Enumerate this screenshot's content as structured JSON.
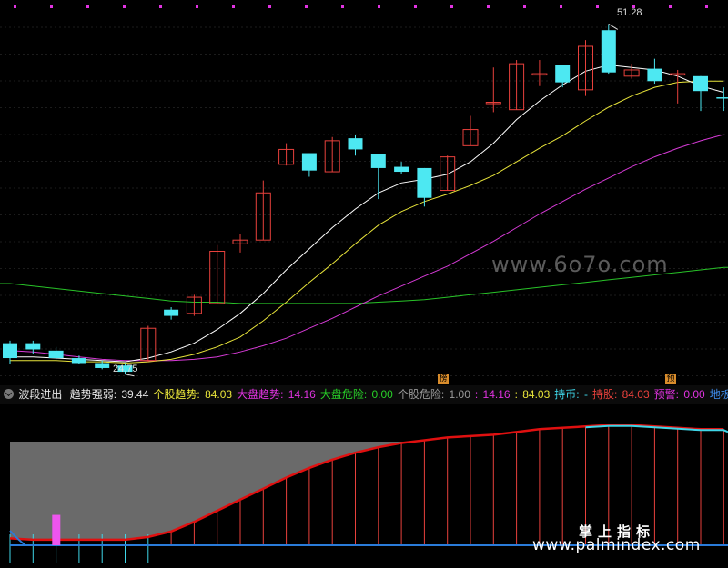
{
  "colors": {
    "up": "#e8413c",
    "down": "#4de8f2",
    "ma_white": "#ffffff",
    "ma_yellow": "#e8e43a",
    "ma_magenta": "#d63ad6",
    "ma_green": "#28c228",
    "dots": "#e233e2",
    "trend_red": "#e01010",
    "fill_gray": "#6a6a6a",
    "base_blue": "#2a7bd9",
    "cyan": "#3fd6e8"
  },
  "watermarks": {
    "top": "www.6o7o.com",
    "bottom_cn": "掌上指标",
    "bottom_url": "www.palmindex.com"
  },
  "price_labels": {
    "high": "51.28",
    "low": "24.75"
  },
  "tags": {
    "tag1": "榜",
    "tag2": "预"
  },
  "indicator_bar": {
    "name": "波段进出",
    "items": [
      {
        "label": "趋势强弱:",
        "value": "39.44",
        "color": "#e6e6e6"
      },
      {
        "label": "个股趋势:",
        "value": "84.03",
        "color": "#e8e43a"
      },
      {
        "label": "大盘趋势:",
        "value": "14.16",
        "color": "#e233e2"
      },
      {
        "label": "大盘危险:",
        "value": "0.00",
        "color": "#28d128"
      },
      {
        "label": "个股危险:",
        "value": "1.00",
        "color": "#9a9a9a"
      },
      {
        "label": ":",
        "value": "14.16",
        "color": "#e233e2"
      },
      {
        "label": ":",
        "value": "84.03",
        "color": "#e8e43a"
      },
      {
        "label": "持币:",
        "value": "-",
        "color": "#3fd6e8"
      },
      {
        "label": "持股:",
        "value": "84.03",
        "color": "#e8413c"
      },
      {
        "label": "预警:",
        "value": "0.00",
        "color": "#e233e2"
      },
      {
        "label": "地板价:",
        "value": "",
        "color": "#3f8ff0"
      }
    ]
  },
  "chart_data": [
    {
      "type": "candlestick",
      "title": "",
      "ylim": [
        22.5,
        52.5
      ],
      "candles": [
        {
          "o": 25.6,
          "h": 25.8,
          "l": 23.9,
          "c": 24.4
        },
        {
          "o": 25.6,
          "h": 25.8,
          "l": 24.7,
          "c": 25.1
        },
        {
          "o": 25.0,
          "h": 25.3,
          "l": 24.3,
          "c": 24.4
        },
        {
          "o": 24.4,
          "h": 24.6,
          "l": 23.9,
          "c": 24.0
        },
        {
          "o": 24.0,
          "h": 24.2,
          "l": 23.5,
          "c": 23.6
        },
        {
          "o": 23.8,
          "h": 24.0,
          "l": 23.1,
          "c": 23.3
        },
        {
          "o": 24.2,
          "h": 27.0,
          "l": 24.1,
          "c": 26.8
        },
        {
          "o": 28.3,
          "h": 28.5,
          "l": 27.5,
          "c": 27.8
        },
        {
          "o": 28.0,
          "h": 29.5,
          "l": 27.8,
          "c": 29.3
        },
        {
          "o": 28.8,
          "h": 33.5,
          "l": 28.8,
          "c": 33.0
        },
        {
          "o": 33.6,
          "h": 34.4,
          "l": 32.9,
          "c": 33.9
        },
        {
          "o": 33.9,
          "h": 38.7,
          "l": 33.9,
          "c": 37.7
        },
        {
          "o": 40.0,
          "h": 41.7,
          "l": 39.9,
          "c": 41.2
        },
        {
          "o": 40.9,
          "h": 40.9,
          "l": 39.0,
          "c": 39.5
        },
        {
          "o": 39.4,
          "h": 42.2,
          "l": 39.4,
          "c": 41.9
        },
        {
          "o": 42.1,
          "h": 42.4,
          "l": 40.7,
          "c": 41.2
        },
        {
          "o": 40.8,
          "h": 40.8,
          "l": 37.2,
          "c": 39.7
        },
        {
          "o": 39.8,
          "h": 40.2,
          "l": 39.2,
          "c": 39.4
        },
        {
          "o": 39.7,
          "h": 39.7,
          "l": 36.6,
          "c": 37.3
        },
        {
          "o": 37.9,
          "h": 40.7,
          "l": 37.9,
          "c": 40.6
        },
        {
          "o": 41.5,
          "h": 43.9,
          "l": 41.5,
          "c": 42.8
        },
        {
          "o": 44.9,
          "h": 47.8,
          "l": 44.2,
          "c": 45.0
        },
        {
          "o": 44.4,
          "h": 48.4,
          "l": 44.4,
          "c": 48.1
        },
        {
          "o": 47.3,
          "h": 48.4,
          "l": 46.3,
          "c": 47.3
        },
        {
          "o": 48.0,
          "h": 48.0,
          "l": 46.2,
          "c": 46.6
        },
        {
          "o": 46.0,
          "h": 50.0,
          "l": 45.5,
          "c": 49.5
        },
        {
          "o": 50.8,
          "h": 51.3,
          "l": 47.3,
          "c": 47.4
        },
        {
          "o": 47.1,
          "h": 48.1,
          "l": 46.9,
          "c": 47.6
        },
        {
          "o": 47.7,
          "h": 48.5,
          "l": 46.5,
          "c": 46.7
        },
        {
          "o": 47.2,
          "h": 47.6,
          "l": 44.9,
          "c": 47.3
        },
        {
          "o": 47.1,
          "h": 47.1,
          "l": 44.3,
          "c": 45.9
        },
        {
          "o": 45.4,
          "h": 46.2,
          "l": 44.3,
          "c": 45.3
        }
      ],
      "ma_white": [
        24.5,
        24.5,
        24.4,
        24.3,
        24.2,
        24.1,
        24.4,
        24.9,
        25.6,
        26.7,
        28.0,
        29.6,
        31.5,
        33.2,
        34.9,
        36.4,
        37.7,
        38.5,
        38.8,
        39.2,
        40.2,
        41.7,
        43.6,
        45.1,
        46.4,
        47.5,
        48.0,
        47.8,
        47.6,
        47.1,
        46.3,
        45.8
      ],
      "ma_yellow": [
        24.2,
        24.2,
        24.2,
        24.1,
        24.1,
        24.0,
        24.1,
        24.3,
        24.7,
        25.3,
        26.1,
        27.4,
        28.9,
        30.5,
        32.0,
        33.6,
        35.1,
        36.2,
        37.0,
        37.6,
        38.3,
        39.1,
        40.2,
        41.3,
        42.3,
        43.5,
        44.6,
        45.5,
        46.2,
        46.6,
        46.7,
        46.7
      ],
      "ma_magenta": [
        25.0,
        24.9,
        24.7,
        24.5,
        24.3,
        24.2,
        24.2,
        24.2,
        24.3,
        24.5,
        24.9,
        25.4,
        26.0,
        26.8,
        27.6,
        28.5,
        29.4,
        30.2,
        31.0,
        31.8,
        32.8,
        33.8,
        34.9,
        36.0,
        37.0,
        38.0,
        38.9,
        39.8,
        40.6,
        41.3,
        41.9,
        42.4
      ],
      "ma_green": [
        30.4,
        30.2,
        30.0,
        29.8,
        29.6,
        29.4,
        29.2,
        29.0,
        28.9,
        28.9,
        28.8,
        28.8,
        28.8,
        28.8,
        28.8,
        28.8,
        28.9,
        29.0,
        29.1,
        29.3,
        29.5,
        29.7,
        29.9,
        30.1,
        30.3,
        30.5,
        30.7,
        30.9,
        31.1,
        31.3,
        31.5,
        31.7
      ]
    },
    {
      "type": "area",
      "title": "波段进出",
      "ylim": [
        0,
        100
      ],
      "trend": [
        5,
        4,
        4,
        4,
        4,
        4,
        6,
        10,
        17,
        25,
        33,
        41,
        49,
        56,
        62,
        67,
        71,
        74,
        76,
        78,
        79,
        80,
        82,
        84,
        85,
        86,
        87,
        87,
        86,
        85,
        84,
        84
      ],
      "sticks_red": [
        0,
        0,
        0,
        0,
        0,
        0,
        0,
        1,
        1,
        1,
        1,
        1,
        1,
        1,
        1,
        1,
        1,
        1,
        1,
        1,
        1,
        1,
        1,
        1,
        1,
        1,
        1,
        1,
        1,
        1,
        1,
        1
      ],
      "pink_bar_index": 1,
      "pink_bar_value": 22
    }
  ]
}
